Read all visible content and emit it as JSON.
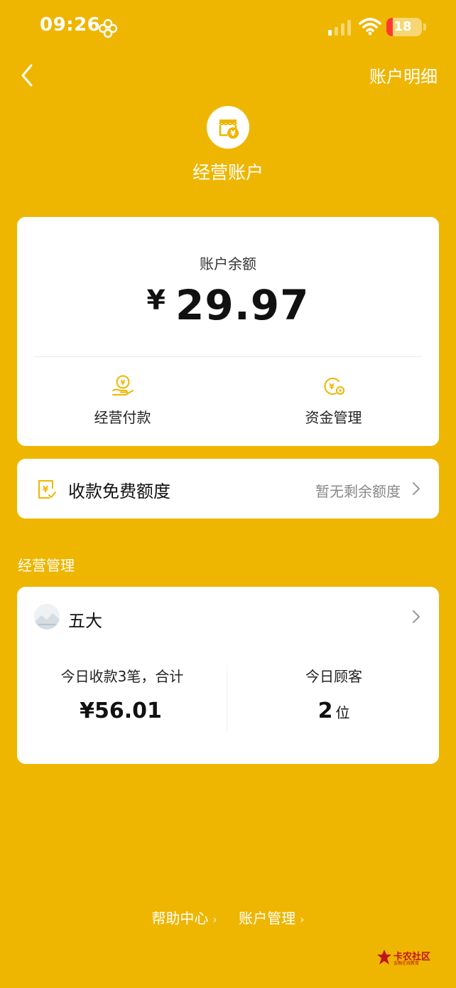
{
  "status_bar": {
    "time": "09:26",
    "battery": "18",
    "battery_level": 0.18
  },
  "nav": {
    "account_detail": "账户明细"
  },
  "header": {
    "title": "经营账户"
  },
  "balance": {
    "label": "账户余额",
    "currency": "¥",
    "amount": "29.97",
    "actions": [
      {
        "label": "经营付款",
        "icon": "hand-coin-icon"
      },
      {
        "label": "资金管理",
        "icon": "coin-settings-icon"
      }
    ]
  },
  "quota": {
    "title": "收款免费额度",
    "value": "暂无剩余额度"
  },
  "section": {
    "title": "经营管理"
  },
  "store": {
    "name": "五大",
    "stats": [
      {
        "label": "今日收款3笔，合计",
        "value": "¥56.01",
        "unit": ""
      },
      {
        "label": "今日顾客",
        "value": "2",
        "unit": "位"
      }
    ]
  },
  "footer": {
    "links": [
      "帮助中心",
      "账户管理"
    ]
  },
  "watermark": {
    "text": "卡农社区",
    "sub": "金融在线教育"
  },
  "colors": {
    "background": "#EEB600",
    "card": "#FFFFFF",
    "accent": "#EEB600"
  }
}
